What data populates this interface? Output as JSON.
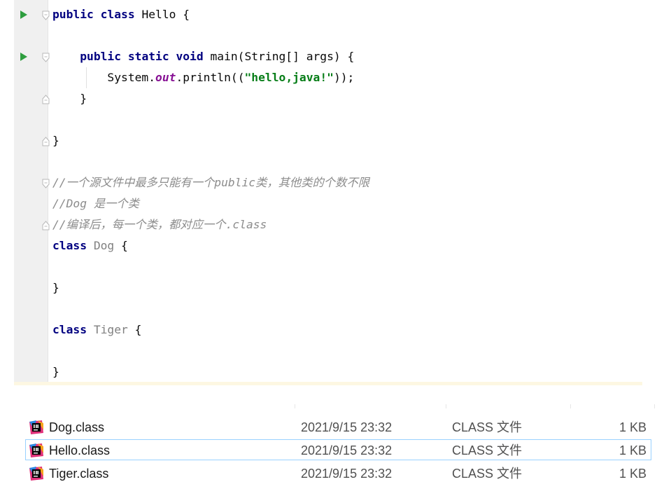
{
  "editor": {
    "colors": {
      "keyword": "#000080",
      "string": "#067d17",
      "static_field": "#871094",
      "comment": "#8c8c8c",
      "unused_class": "#808080",
      "run_icon": "#2e9e3f"
    },
    "lines": [
      {
        "parts": [
          {
            "t": "public class",
            "s": "kw"
          },
          {
            "t": " Hello {",
            "s": ""
          }
        ]
      },
      {
        "parts": [
          {
            "t": "    ",
            "s": ""
          },
          {
            "t": "public static void",
            "s": "kw"
          },
          {
            "t": " main(String[] args) {",
            "s": ""
          }
        ]
      },
      {
        "parts": [
          {
            "t": "        System.",
            "s": ""
          },
          {
            "t": "out",
            "s": "fld"
          },
          {
            "t": ".println((",
            "s": ""
          },
          {
            "t": "\"hello,java!\"",
            "s": "str"
          },
          {
            "t": "));",
            "s": ""
          }
        ]
      },
      {
        "parts": [
          {
            "t": "    }",
            "s": ""
          }
        ]
      },
      {
        "parts": [
          {
            "t": "}",
            "s": ""
          }
        ]
      },
      {
        "parts": [
          {
            "t": "//一个源文件中最多只能有一个public类，其他类的个数不限",
            "s": "cmt"
          }
        ]
      },
      {
        "parts": [
          {
            "t": "//Dog 是一个类",
            "s": "cmt"
          }
        ]
      },
      {
        "parts": [
          {
            "t": "//编译后，每一个类，都对应一个.class",
            "s": "cmt"
          }
        ]
      },
      {
        "parts": [
          {
            "t": "class",
            "s": "kw"
          },
          {
            "t": " ",
            "s": ""
          },
          {
            "t": "Dog",
            "s": "grey"
          },
          {
            "t": " {",
            "s": ""
          }
        ]
      },
      {
        "parts": [
          {
            "t": "}",
            "s": ""
          }
        ]
      },
      {
        "parts": [
          {
            "t": "class",
            "s": "kw"
          },
          {
            "t": " ",
            "s": ""
          },
          {
            "t": "Tiger",
            "s": "grey"
          },
          {
            "t": " {",
            "s": ""
          }
        ]
      },
      {
        "parts": [
          {
            "t": "}",
            "s": ""
          }
        ]
      }
    ],
    "gutter_icons": [
      {
        "type": "run-icon",
        "line": 0
      },
      {
        "type": "fold-open-icon",
        "line": 0
      },
      {
        "type": "run-icon",
        "line": 1
      },
      {
        "type": "fold-open-icon",
        "line": 1
      },
      {
        "type": "fold-close-icon",
        "line": 3
      },
      {
        "type": "fold-close-icon",
        "line": 4
      },
      {
        "type": "fold-open-icon",
        "line": 5
      },
      {
        "type": "fold-close-icon",
        "line": 7
      }
    ]
  },
  "file_list": {
    "files": [
      {
        "name": "Dog.class",
        "date": "2021/9/15 23:32",
        "type": "CLASS 文件",
        "size": "1 KB",
        "selected": false,
        "icon": "intellij-file-icon"
      },
      {
        "name": "Hello.class",
        "date": "2021/9/15 23:32",
        "type": "CLASS 文件",
        "size": "1 KB",
        "selected": true,
        "icon": "intellij-file-icon"
      },
      {
        "name": "Tiger.class",
        "date": "2021/9/15 23:32",
        "type": "CLASS 文件",
        "size": "1 KB",
        "selected": false,
        "icon": "intellij-file-icon"
      }
    ]
  }
}
